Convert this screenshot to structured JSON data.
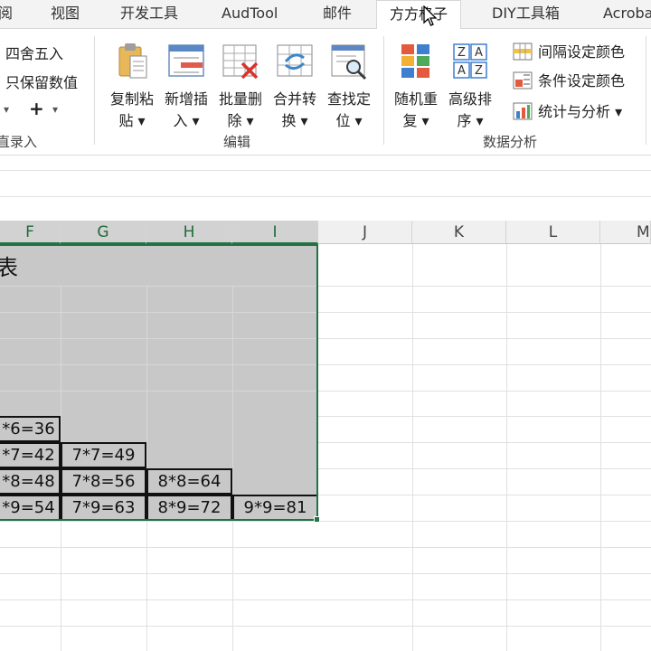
{
  "tabs": [
    "阅",
    "视图",
    "开发工具",
    "AudTool",
    "邮件",
    "方方格子",
    "DIY工具箱",
    "Acroba"
  ],
  "active_tab_index": 5,
  "ribbon": {
    "left_group": {
      "round_label": "四舍五入",
      "keep_value_label": "只保留数值",
      "plus_label": "+",
      "group_label": "直录入"
    },
    "edit_group": {
      "label": "编辑",
      "buttons": [
        {
          "l1": "复制粘",
          "l2": "贴 ▾",
          "icon": "paste-icon"
        },
        {
          "l1": "新增插",
          "l2": "入 ▾",
          "icon": "insert-icon"
        },
        {
          "l1": "批量删",
          "l2": "除 ▾",
          "icon": "batch-delete-icon"
        },
        {
          "l1": "合并转",
          "l2": "换 ▾",
          "icon": "merge-convert-icon"
        },
        {
          "l1": "查找定",
          "l2": "位 ▾",
          "icon": "find-locate-icon"
        }
      ]
    },
    "data_group": {
      "label": "数据分析",
      "buttons": [
        {
          "l1": "随机重",
          "l2": "复 ▾",
          "icon": "random-repeat-icon"
        },
        {
          "l1": "高级排",
          "l2": "序 ▾",
          "icon": "advanced-sort-icon"
        }
      ],
      "small_buttons": [
        {
          "text": "间隔设定颜色",
          "icon": "interval-color-icon"
        },
        {
          "text": "条件设定颜色",
          "icon": "condition-color-icon"
        },
        {
          "text": "统计与分析 ▾",
          "icon": "statistics-icon"
        }
      ]
    }
  },
  "sheet": {
    "columns": [
      "F",
      "G",
      "H",
      "I",
      "J",
      "K",
      "L",
      "M"
    ],
    "title_fragment": "表",
    "cells": {
      "r6": [
        "*6=36"
      ],
      "r7": [
        "*7=42",
        "7*7=49"
      ],
      "r8": [
        "*8=48",
        "7*8=56",
        "8*8=64"
      ],
      "r9": [
        "*9=54",
        "7*9=63",
        "8*9=72",
        "9*9=81"
      ]
    }
  },
  "colors": {
    "accent_green": "#217346",
    "selection_fill": "#c8c8c8"
  }
}
